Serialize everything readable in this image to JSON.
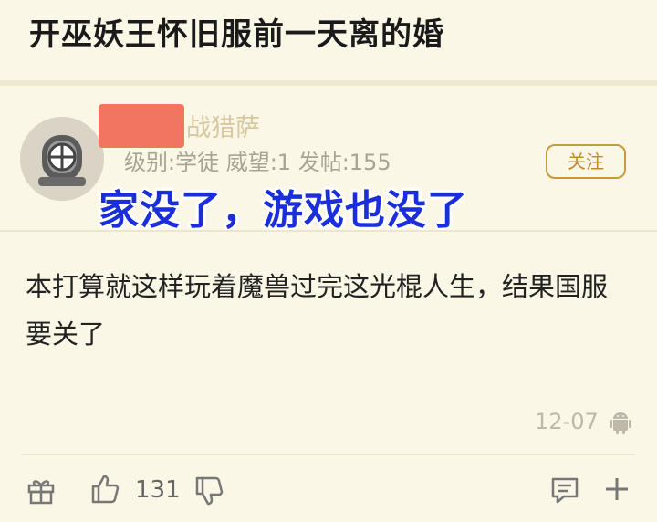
{
  "post": {
    "title": "开巫妖王怀旧服前一天离的婚"
  },
  "author": {
    "name_visible_part": "战猎萨",
    "meta": "级别:学徒 威望:1 发帖:155",
    "follow_label": "关注"
  },
  "overlay_caption": "家没了，游戏也没了",
  "content": {
    "body": "本打算就这样玩着魔兽过完这光棍人生，结果国服要关了",
    "date": "12-07"
  },
  "actions": {
    "like_count": "131"
  },
  "colors": {
    "background": "#fbf7e6",
    "accent": "#c99a3c",
    "caption": "#1a2fd9",
    "redaction": "#f2765f"
  },
  "icons": [
    "gift-icon",
    "thumbs-up-icon",
    "thumbs-down-icon",
    "comment-icon",
    "plus-icon",
    "android-icon"
  ]
}
